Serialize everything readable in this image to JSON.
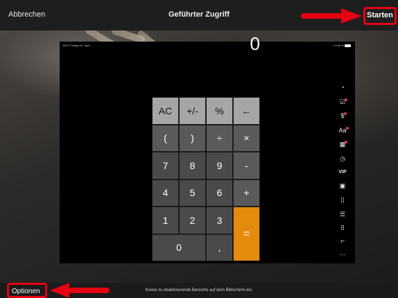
{
  "topbar": {
    "cancel_label": "Abbrechen",
    "title": "Geführter Zugriff",
    "start_label": "Starten"
  },
  "statusbar": {
    "time": "18:07",
    "date": "Freitag 19. Sept.",
    "battery": "90 %"
  },
  "calculator": {
    "display_value": "0",
    "keys": [
      "AC",
      "+/-",
      "%",
      "←",
      "(",
      ")",
      "÷",
      "×",
      "7",
      "8",
      "9",
      "-",
      "4",
      "5",
      "6",
      "+",
      "1",
      "2",
      "3",
      "=",
      "0",
      ","
    ]
  },
  "rail": {
    "icons": [
      "drop-icon",
      "checklist-icon",
      "dollar-icon",
      "font-size-icon",
      "grid-icon",
      "clock-icon",
      "vip-icon",
      "star-box-icon",
      "phone-icon",
      "list-icon",
      "dots-grid-icon",
      "math-ops-icon",
      "more-icon"
    ],
    "vip_label": "VIP"
  },
  "bottombar": {
    "options_label": "Optionen",
    "hint": "Kreise zu deaktivierende Bereiche auf dem Bildschirm ein."
  },
  "colors": {
    "accent_orange": "#e48b0e",
    "annotation_red": "#e50012"
  }
}
